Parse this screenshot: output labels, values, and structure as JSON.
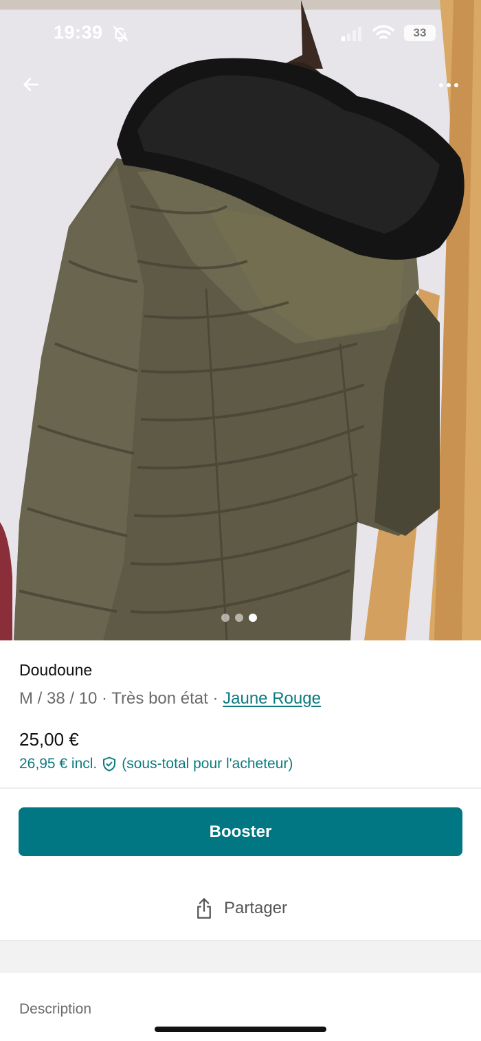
{
  "status_bar": {
    "time": "19:39",
    "battery": "33"
  },
  "listing": {
    "title": "Doudoune",
    "size_condition": "M / 38 / 10 · Très bon état · ",
    "brand": "Jaune Rouge",
    "price": "25,00 €",
    "price_incl": "26,95 € incl.",
    "price_incl_note": "(sous-total pour l'acheteur)"
  },
  "gallery": {
    "image_count": 3,
    "active_index": 2
  },
  "actions": {
    "booster_label": "Booster",
    "share_label": "Partager"
  },
  "section": {
    "description_label": "Description"
  },
  "icons": {
    "back": "arrow-left-icon",
    "more": "more-horizontal-icon",
    "share": "share-icon",
    "shield": "shield-check-icon"
  },
  "colors": {
    "accent": "#007782",
    "link": "#0b7a80"
  }
}
